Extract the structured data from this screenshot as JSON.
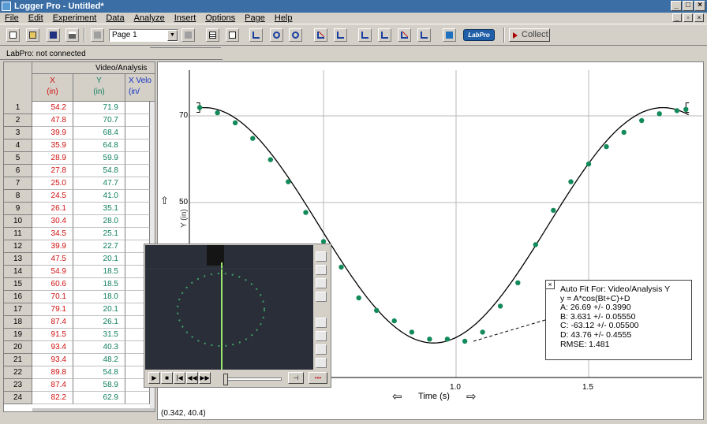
{
  "window": {
    "title": "Logger Pro - Untitled*"
  },
  "menu": [
    "File",
    "Edit",
    "Experiment",
    "Data",
    "Analyze",
    "Insert",
    "Options",
    "Page",
    "Help"
  ],
  "toolbar": {
    "page_select": "Page 1",
    "collect_label": "Collect",
    "labpro_label": "LabPro"
  },
  "status": {
    "connection": "LabPro: not connected"
  },
  "table": {
    "dataset": "Video/Analysis",
    "columns": [
      {
        "name": "X",
        "unit": "(in)"
      },
      {
        "name": "Y",
        "unit": "(in)"
      },
      {
        "name": "X Velo",
        "unit": "(in/"
      }
    ],
    "rows": [
      {
        "n": "1",
        "x": "54.2",
        "y": "71.9"
      },
      {
        "n": "2",
        "x": "47.8",
        "y": "70.7"
      },
      {
        "n": "3",
        "x": "39.9",
        "y": "68.4"
      },
      {
        "n": "4",
        "x": "35.9",
        "y": "64.8"
      },
      {
        "n": "5",
        "x": "28.9",
        "y": "59.9"
      },
      {
        "n": "6",
        "x": "27.8",
        "y": "54.8"
      },
      {
        "n": "7",
        "x": "25.0",
        "y": "47.7"
      },
      {
        "n": "8",
        "x": "24.5",
        "y": "41.0"
      },
      {
        "n": "9",
        "x": "26.1",
        "y": "35.1"
      },
      {
        "n": "10",
        "x": "30.4",
        "y": "28.0"
      },
      {
        "n": "11",
        "x": "34.5",
        "y": "25.1"
      },
      {
        "n": "12",
        "x": "39.9",
        "y": "22.7"
      },
      {
        "n": "13",
        "x": "47.5",
        "y": "20.1"
      },
      {
        "n": "14",
        "x": "54.9",
        "y": "18.5"
      },
      {
        "n": "15",
        "x": "60.6",
        "y": "18.5"
      },
      {
        "n": "16",
        "x": "70.1",
        "y": "18.0"
      },
      {
        "n": "17",
        "x": "79.1",
        "y": "20.1"
      },
      {
        "n": "18",
        "x": "87.4",
        "y": "26.1"
      },
      {
        "n": "19",
        "x": "91.5",
        "y": "31.5"
      },
      {
        "n": "20",
        "x": "93.4",
        "y": "40.3"
      },
      {
        "n": "21",
        "x": "93.4",
        "y": "48.2"
      },
      {
        "n": "22",
        "x": "89.8",
        "y": "54.8"
      },
      {
        "n": "23",
        "x": "87.4",
        "y": "58.9"
      },
      {
        "n": "24",
        "x": "82.2",
        "y": "62.9"
      }
    ]
  },
  "graph": {
    "x_label": "Time (s)",
    "y_label": "Y (in)",
    "y_ticks": [
      "70",
      "50"
    ],
    "x_ticks": [
      "1.0",
      "1.5"
    ],
    "coord_readout": "(0.342, 40.4)",
    "fit_lines": [
      "Auto Fit For: Video/Analysis Y",
      "y = A*cos(Bt+C)+D",
      "A: 26.69 +/- 0.3990",
      "B: 3.631 +/- 0.05550",
      "C: -63.12 +/- 0.05500",
      "D: 43.76 +/- 0.4555",
      "RMSE: 1.481"
    ]
  },
  "colors": {
    "x_col": "#d01010",
    "y_col": "#108060",
    "points": "#128a5a",
    "title_bar": "#3a6ea5"
  },
  "chart_data": {
    "type": "scatter",
    "x_label": "Time (s)",
    "y_label": "Y (in)",
    "fit": {
      "model": "y = A*cos(Bt+C)+D",
      "A": 26.69,
      "B": 3.631,
      "C": -63.12,
      "D": 43.76
    },
    "series": [
      {
        "name": "Video/Analysis Y",
        "points": [
          [
            0.033,
            71.9
          ],
          [
            0.1,
            70.7
          ],
          [
            0.167,
            68.4
          ],
          [
            0.233,
            64.8
          ],
          [
            0.3,
            59.9
          ],
          [
            0.367,
            54.8
          ],
          [
            0.433,
            47.7
          ],
          [
            0.5,
            41.0
          ],
          [
            0.567,
            35.1
          ],
          [
            0.633,
            28.0
          ],
          [
            0.7,
            25.1
          ],
          [
            0.767,
            22.7
          ],
          [
            0.833,
            20.1
          ],
          [
            0.9,
            18.5
          ],
          [
            0.967,
            18.5
          ],
          [
            1.033,
            18.0
          ],
          [
            1.1,
            20.1
          ],
          [
            1.167,
            26.1
          ],
          [
            1.233,
            31.5
          ],
          [
            1.3,
            40.3
          ],
          [
            1.367,
            48.2
          ],
          [
            1.433,
            54.8
          ],
          [
            1.5,
            58.9
          ],
          [
            1.567,
            62.9
          ],
          [
            1.633,
            66.2
          ],
          [
            1.7,
            68.9
          ],
          [
            1.767,
            70.5
          ],
          [
            1.833,
            71.2
          ],
          [
            1.867,
            71.5
          ]
        ]
      }
    ]
  }
}
